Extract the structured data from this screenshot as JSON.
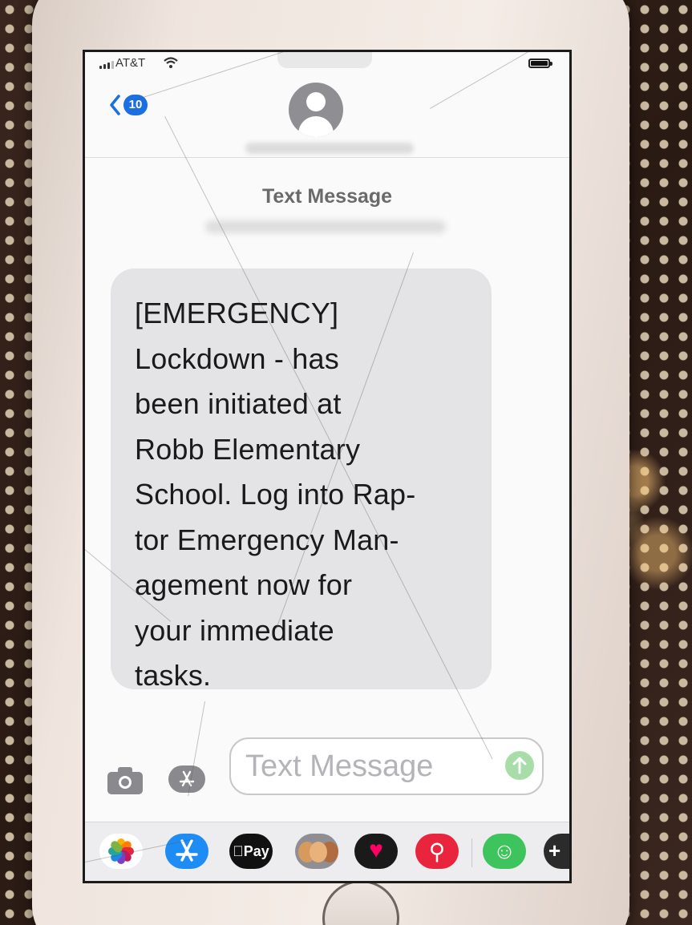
{
  "status_bar": {
    "carrier": "AT&T",
    "wifi_icon": "wifi-icon",
    "battery_icon": "battery-icon",
    "battery_level": 1.0
  },
  "header": {
    "back_badge_count": "10",
    "avatar_icon": "person-icon"
  },
  "thread": {
    "label": "Text Message",
    "messages": [
      {
        "direction": "incoming",
        "text": "[EMERGENCY]\nLockdown -  has\nbeen initiated at\nRobb Elementary\nSchool. Log into Rap-\ntor Emergency Man-\nagement now for\nyour immediate\ntasks."
      }
    ]
  },
  "composer": {
    "placeholder": "Text Message",
    "camera_icon": "camera-icon",
    "apps_icon": "app-store-icon",
    "send_icon": "arrow-up-icon"
  },
  "app_strip": {
    "apple_pay_label": "Pay",
    "apps": [
      "photos",
      "app-store",
      "apple-pay",
      "memoji",
      "digital-touch",
      "search-images",
      "stickers",
      "more"
    ]
  },
  "colors": {
    "badge_blue": "#1b6fe0",
    "bubble_gray": "#e4e4e6",
    "send_green": "#a8dca8"
  }
}
